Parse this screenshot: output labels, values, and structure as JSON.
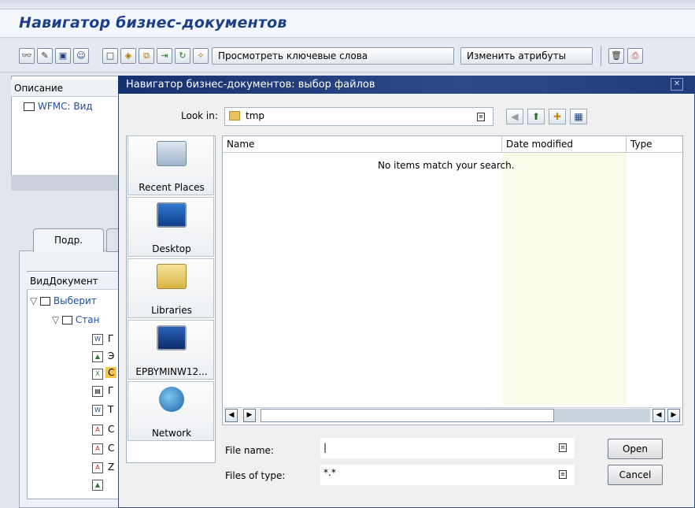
{
  "sap": {
    "title": "Навигатор бизнес-документов",
    "toolbar": {
      "icons": [
        "glasses-icon",
        "pencil-icon",
        "save-icon",
        "user-icon",
        "new-document-icon",
        "link-icon",
        "copy-icon",
        "export-icon",
        "refresh-icon",
        "wand-icon"
      ],
      "view_keywords_label": "Просмотреть ключевые слова",
      "change_attributes_label": "Изменить атрибуты",
      "right_icons": [
        "trash-icon",
        "print-icon"
      ]
    },
    "description_header": "Описание",
    "description_row": "WFMC: Вид",
    "tab_label": "Подр.",
    "tree_header": "ВидДокумент",
    "tree_rows": [
      "Выберит",
      "Стан"
    ],
    "doc_letters": [
      "Г",
      "Э",
      "С",
      "Г",
      "Т",
      "С",
      "С",
      "Z",
      ""
    ]
  },
  "dialog": {
    "title": "Навигатор бизнес-документов: выбор файлов",
    "close_label": "✕",
    "look_in_label": "Look in:",
    "look_in_value": "tmp",
    "places": [
      "Recent Places",
      "Desktop",
      "Libraries",
      "EPBYMINW12...",
      "Network"
    ],
    "columns": [
      "Name",
      "Date modified",
      "Type"
    ],
    "empty_message": "No items match your search.",
    "file_name_label": "File name:",
    "file_name_value": "|",
    "files_of_type_label": "Files of type:",
    "files_of_type_value": "*.*",
    "open_label": "Open",
    "cancel_label": "Cancel"
  }
}
